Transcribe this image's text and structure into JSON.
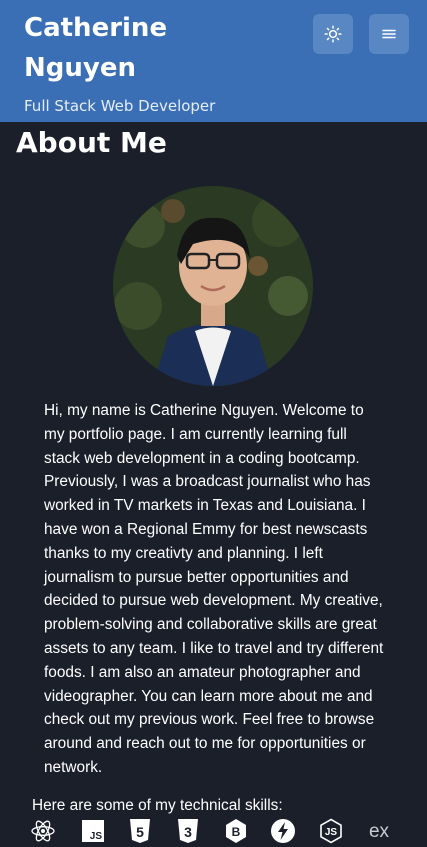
{
  "header": {
    "name_line1": "Catherine",
    "name_line2": "Nguyen",
    "subtitle": "Full Stack Web Developer",
    "theme_icon": "sun-icon",
    "menu_icon": "hamburger-menu-icon"
  },
  "colors": {
    "header_bg": "#3a6eb5",
    "button_bg": "#5987c4",
    "page_bg": "#1b1f2a",
    "text": "#ffffff"
  },
  "about": {
    "title": "About Me",
    "profile_photo": "profile-photo",
    "bio": "Hi, my name is Catherine Nguyen. Welcome to my portfolio page. I am currently learning full stack web development in a coding bootcamp. Previously, I was a broadcast journalist who has worked in TV markets in Texas and Louisiana. I have won a Regional Emmy for best newscasts thanks to my creativty and planning. I left journalism to pursue better opportunities and decided to pursue web development. My creative, problem-solving and collaborative skills are great assets to any team. I like to travel and try different foods. I am also an amateur photographer and videographer. You can learn more about me and check out my previous work. Feel free to browse around and reach out to me for opportunities or network."
  },
  "skills": {
    "intro": "Here are some of my technical skills:",
    "icons": [
      {
        "icon": "react-icon",
        "label": "React"
      },
      {
        "icon": "javascript-icon",
        "label": "JS"
      },
      {
        "icon": "html5-icon",
        "label": "5"
      },
      {
        "icon": "css3-icon",
        "label": "3"
      },
      {
        "icon": "bootstrap-icon",
        "label": "B"
      },
      {
        "icon": "lightning-icon",
        "label": ""
      },
      {
        "icon": "nodejs-icon",
        "label": "JS"
      },
      {
        "icon": "express-icon",
        "label": "ex"
      }
    ]
  }
}
